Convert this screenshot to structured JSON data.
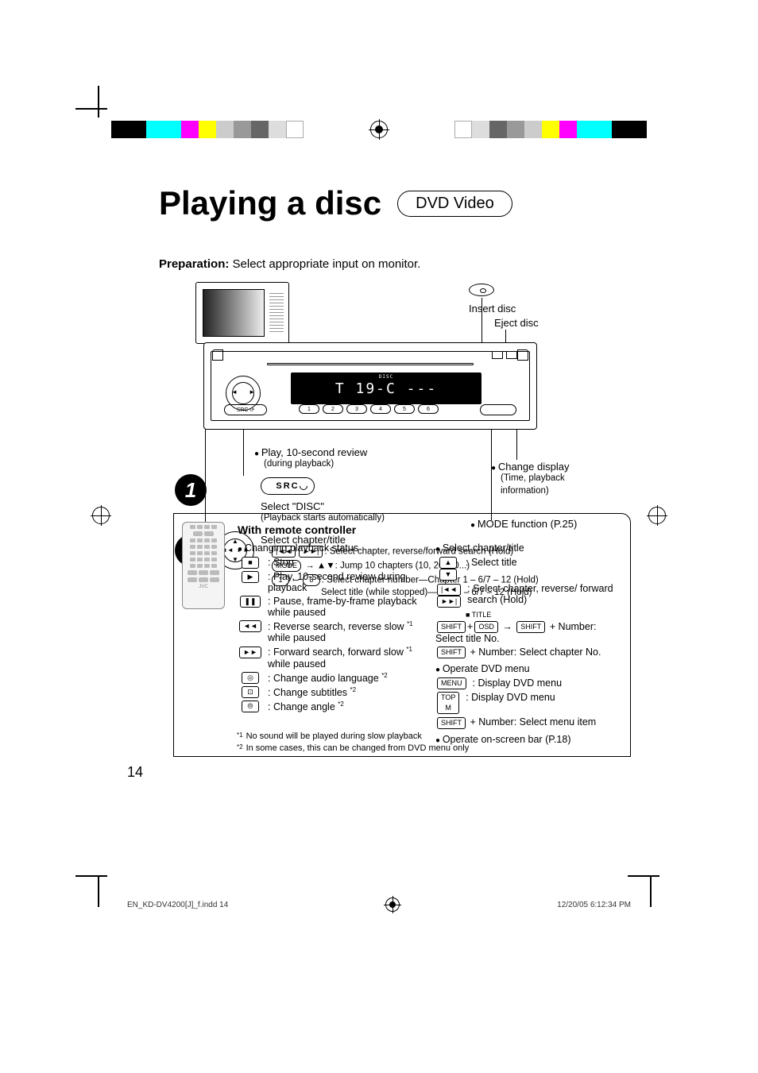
{
  "header": {
    "title": "Playing a disc",
    "badge": "DVD Video"
  },
  "preparation": {
    "label": "Preparation:",
    "text": "Select appropriate input on monitor."
  },
  "labels": {
    "insert": "Insert disc",
    "eject": "Eject disc",
    "change_display": "Change display",
    "change_display_sub": "(Time, playback information)",
    "mode_fn": "MODE function (P.25)",
    "play_review": "Play, 10-second review",
    "play_review_sub": "(during playback)",
    "select_disc": "Select \"DISC\"",
    "select_disc_sub": "(Playback starts automatically)",
    "select_chapter": "Select chapter/title",
    "sc_line1": ": Select chapter, reverse/forward search (Hold)",
    "sc_line2": ": Jump 10 chapters (10, 20, 30...)",
    "sc_line3": ": Select chapter number—Chapter 1 – 6/7 – 12 (Hold)",
    "sc_line4": "Select title (while stopped)—Title 1 – 6/7 – 12 (Hold)",
    "src": "SRC"
  },
  "unit_display": "T 19-C ---",
  "unit_buttons": [
    "1",
    "2",
    "3",
    "4",
    "5",
    "6"
  ],
  "unit_top_tiny": "DISC",
  "remote": {
    "title": "With remote controller",
    "left": {
      "head": "Changing playback status",
      "items": [
        {
          "icon": "■",
          "text": ": Stop"
        },
        {
          "icon": "▶",
          "text": ": Play, 10-second review during playback"
        },
        {
          "icon": "❚❚",
          "text": ": Pause, frame-by-frame playback while paused"
        },
        {
          "icon": "◄◄",
          "text": ": Reverse search, reverse slow ",
          "sup": "*1",
          "tail": " while paused"
        },
        {
          "icon": "►►",
          "text": ": Forward search, forward slow ",
          "sup": "*1",
          "tail": " while paused"
        },
        {
          "icon": "◎",
          "text": ": Change audio language ",
          "sup": "*2"
        },
        {
          "icon": "⊡",
          "text": ": Change subtitles ",
          "sup": "*2"
        },
        {
          "icon": "⦾",
          "text": ": Change angle ",
          "sup": "*2"
        }
      ]
    },
    "right": {
      "head1": "Select chapter/title",
      "r1a": ": Select title",
      "r1b": ": Select chapter, reverse/ forward search (Hold)",
      "title_lbl": "■ TITLE",
      "r1c_pre": "+",
      "r1c_post": " + Number: Select title No.",
      "r1d": " + Number: Select chapter No.",
      "head2": "Operate DVD menu",
      "r2a": ": Display DVD menu",
      "r2b": ": Display DVD menu",
      "r2c": " + Number: Select menu item",
      "head3": "Operate on-screen bar (P.18)",
      "keys": {
        "up": "▲",
        "down": "▼",
        "prev": "|◄◄",
        "next": "►►|",
        "shift": "SHIFT",
        "osd": "OSD",
        "menu": "MENU",
        "topm": "TOP M",
        "arrow": "→"
      }
    }
  },
  "footnotes": {
    "f1": "No sound will be played during slow playback",
    "f2": "In some cases, this can be changed from DVD menu only"
  },
  "page_number": "14",
  "footer": {
    "left": "EN_KD-DV4200[J]_f.indd   14",
    "right": "12/20/05   6:12:34 PM"
  }
}
